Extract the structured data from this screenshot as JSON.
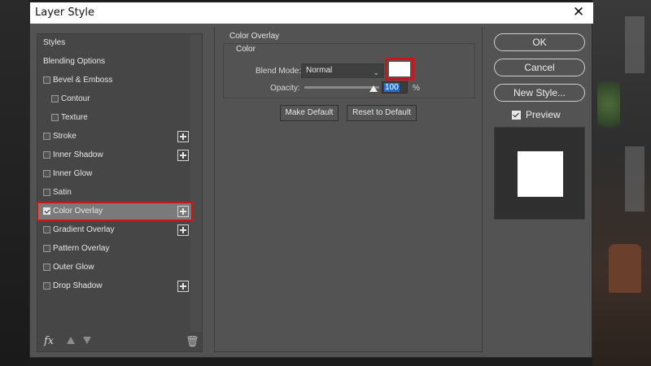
{
  "dialog": {
    "title": "Layer Style",
    "close_glyph": "✕"
  },
  "styles_list": {
    "items": [
      {
        "label": "Styles"
      },
      {
        "label": "Blending Options"
      },
      {
        "label": "Bevel & Emboss",
        "checked": false
      },
      {
        "label": "Contour",
        "checked": false
      },
      {
        "label": "Texture",
        "checked": false
      },
      {
        "label": "Stroke",
        "checked": false,
        "has_plus": true
      },
      {
        "label": "Inner Shadow",
        "checked": false,
        "has_plus": true
      },
      {
        "label": "Inner Glow",
        "checked": false
      },
      {
        "label": "Satin",
        "checked": false
      },
      {
        "label": "Color Overlay",
        "checked": true,
        "has_plus": true,
        "selected": true
      },
      {
        "label": "Gradient Overlay",
        "checked": false,
        "has_plus": true
      },
      {
        "label": "Pattern Overlay",
        "checked": false
      },
      {
        "label": "Outer Glow",
        "checked": false
      },
      {
        "label": "Drop Shadow",
        "checked": false,
        "has_plus": true
      }
    ],
    "fx_label": "fx",
    "icons": [
      "fx-icon",
      "move-up-icon",
      "move-down-icon",
      "trash-icon"
    ]
  },
  "color_overlay": {
    "group_title": "Color Overlay",
    "sub_title": "Color",
    "blend_mode_label": "Blend Mode:",
    "blend_mode_value": "Normal",
    "overlay_color": "#ffffff",
    "opacity_label": "Opacity:",
    "opacity_value": "100",
    "opacity_unit": "%",
    "make_default": "Make Default",
    "reset_default": "Reset to Default"
  },
  "actions": {
    "ok": "OK",
    "cancel": "Cancel",
    "new_style": "New Style...",
    "preview_label": "Preview",
    "preview_checked": true
  },
  "colors": {
    "dialog_bg": "#535353",
    "highlight_red": "#c8161d",
    "selection_blue": "#1f6fd1"
  }
}
